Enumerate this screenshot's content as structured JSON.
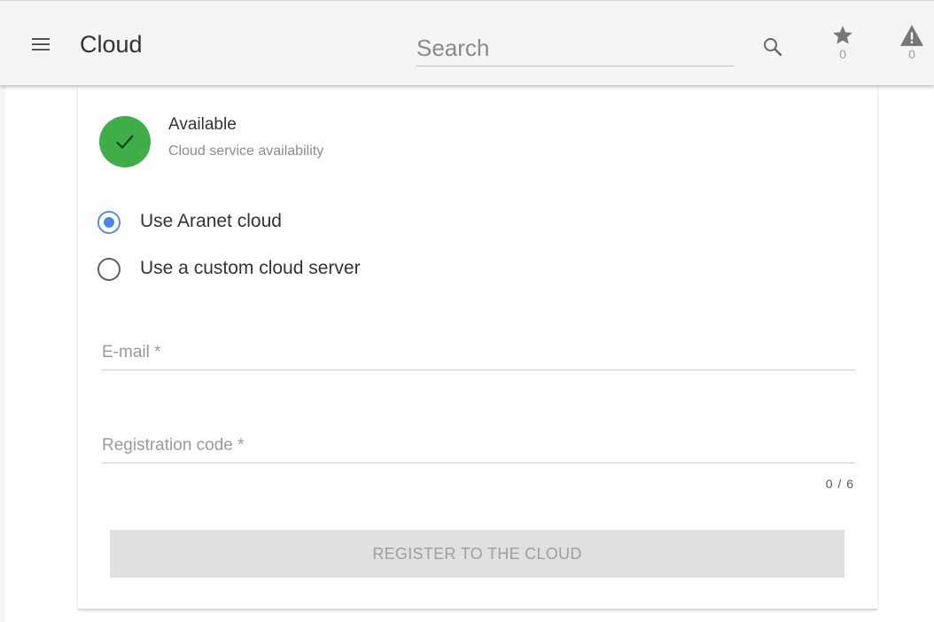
{
  "appbar": {
    "title": "Cloud",
    "search_placeholder": "Search",
    "favorites_count": "0",
    "alerts_count": "0"
  },
  "status": {
    "title": "Available",
    "subtitle": "Cloud service availability",
    "color": "#3fae49"
  },
  "options": {
    "aranet_label": "Use Aranet cloud",
    "custom_label": "Use a custom cloud server",
    "selected": "aranet"
  },
  "form": {
    "email_placeholder": "E-mail *",
    "code_placeholder": "Registration code *",
    "code_counter": "0 / 6"
  },
  "actions": {
    "register_label": "REGISTER TO THE CLOUD"
  },
  "colors": {
    "accent": "#4a86e8",
    "success": "#3fae49",
    "disabled_button": "#e0e0e0"
  },
  "icons": [
    "menu-icon",
    "search-icon",
    "star-icon",
    "alert-icon",
    "check-icon"
  ]
}
